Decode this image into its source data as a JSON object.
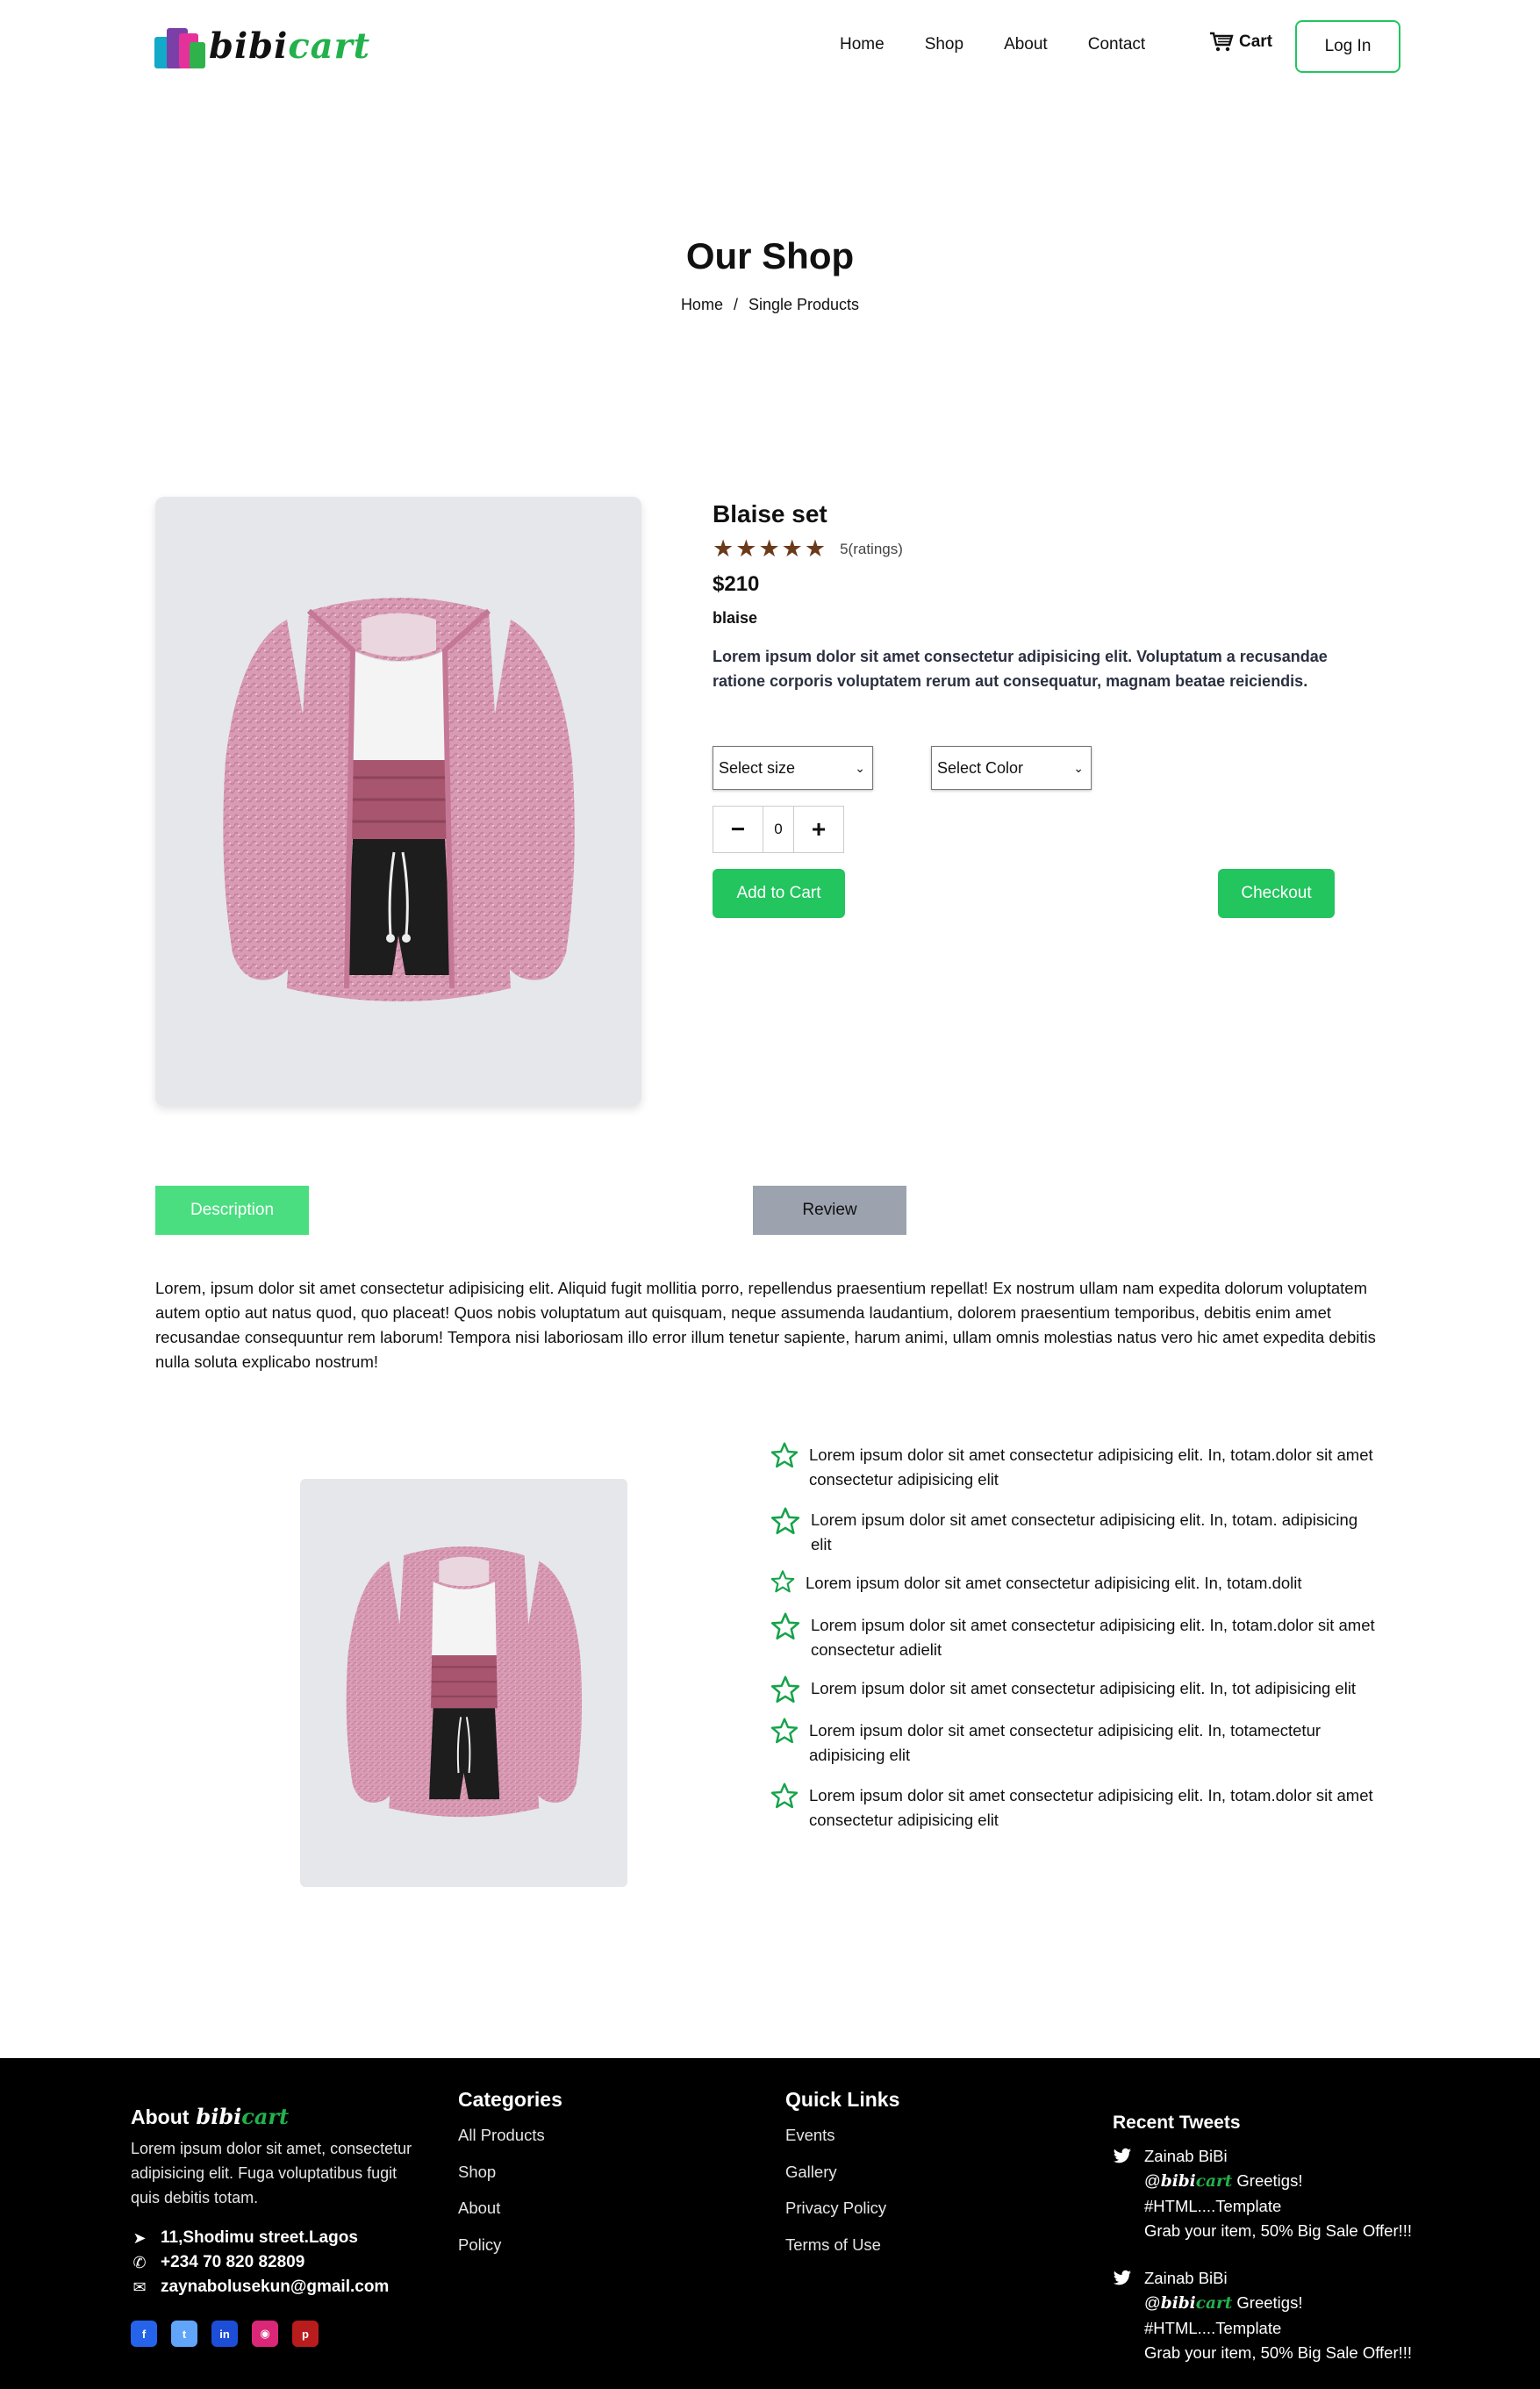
{
  "nav": {
    "logo": {
      "part1": "bibi",
      "part2": "cart"
    },
    "links": [
      "Home",
      "Shop",
      "About",
      "Contact"
    ],
    "cart_label": "Cart",
    "login_label": "Log In"
  },
  "hero": {
    "title": "Our Shop",
    "breadcrumb": {
      "home": "Home",
      "separator": "/",
      "current": "Single Products"
    }
  },
  "product": {
    "title": "Blaise set",
    "rating_stars": 5,
    "ratings_text": "5(ratings)",
    "price": "$210",
    "brand": "blaise",
    "description": "Lorem ipsum dolor sit amet consectetur adipisicing elit. Voluptatum a recusandae ratione corporis voluptatem rerum aut consequatur, magnam beatae reiciendis.",
    "size_select": "Select size",
    "color_select": "Select Color",
    "quantity": "0",
    "add_to_cart": "Add to Cart",
    "checkout": "Checkout"
  },
  "tabs": {
    "description": "Description",
    "review": "Review"
  },
  "long_description": "Lorem, ipsum dolor sit amet consectetur adipisicing elit. Aliquid fugit mollitia porro, repellendus praesentium repellat! Ex nostrum ullam nam expedita dolorum voluptatem autem optio aut natus quod, quo placeat! Quos nobis voluptatum aut quisquam, neque assumenda laudantium, dolorem praesentium temporibus, debitis enim amet recusandae consequuntur rem laborum! Tempora nisi laboriosam illo error illum tenetur sapiente, harum animi, ullam omnis molestias natus vero hic amet expedita debitis nulla soluta explicabo nostrum!",
  "features": [
    "Lorem ipsum dolor sit amet consectetur adipisicing elit. In, totam.dolor sit amet consectetur adipisicing elit",
    "Lorem ipsum dolor sit amet consectetur adipisicing elit. In, totam. adipisicing elit",
    "Lorem ipsum dolor sit amet consectetur adipisicing elit. In, totam.dolit",
    "Lorem ipsum dolor sit amet consectetur adipisicing elit. In, totam.dolor sit amet consectetur adielit",
    "Lorem ipsum dolor sit amet consectetur adipisicing elit. In, tot adipisicing elit",
    "Lorem ipsum dolor sit amet consectetur adipisicing elit. In, totamectetur adipisicing elit",
    "Lorem ipsum dolor sit amet consectetur adipisicing elit. In, totam.dolor sit amet consectetur adipisicing elit"
  ],
  "footer": {
    "about": {
      "heading": "About",
      "text": "Lorem ipsum dolor sit amet, consectetur adipisicing elit. Fuga voluptatibus fugit quis debitis totam.",
      "address": "11,Shodimu street.Lagos",
      "phone": "+234 70 820 82809",
      "email": "zaynabolusekun@gmail.com",
      "socials": [
        "facebook-icon",
        "twitter-icon",
        "linkedin-icon",
        "instagram-icon",
        "pinterest-icon"
      ]
    },
    "categories": {
      "heading": "Categories",
      "links": [
        "All Products",
        "Shop",
        "About",
        "Policy"
      ]
    },
    "quick_links": {
      "heading": "Quick Links",
      "links": [
        "Events",
        "Gallery",
        "Privacy Policy",
        "Terms of Use"
      ]
    },
    "tweets": {
      "heading": "Recent Tweets",
      "items": [
        {
          "author": "Zainab BiBi",
          "at": "@",
          "greeting": "Greetigs!",
          "tag": "#HTML....Template",
          "offer": "Grab your item, 50% Big Sale Offer!!!"
        },
        {
          "author": "Zainab BiBi",
          "at": "@",
          "greeting": "Greetigs!",
          "tag": "#HTML....Template",
          "offer": "Grab your item, 50% Big Sale Offer!!!"
        }
      ]
    }
  },
  "colors": {
    "accent": "#22c55e",
    "star": "#6b3a1a",
    "tab_active": "#4ade80",
    "tab_inactive": "#9ca3af"
  }
}
